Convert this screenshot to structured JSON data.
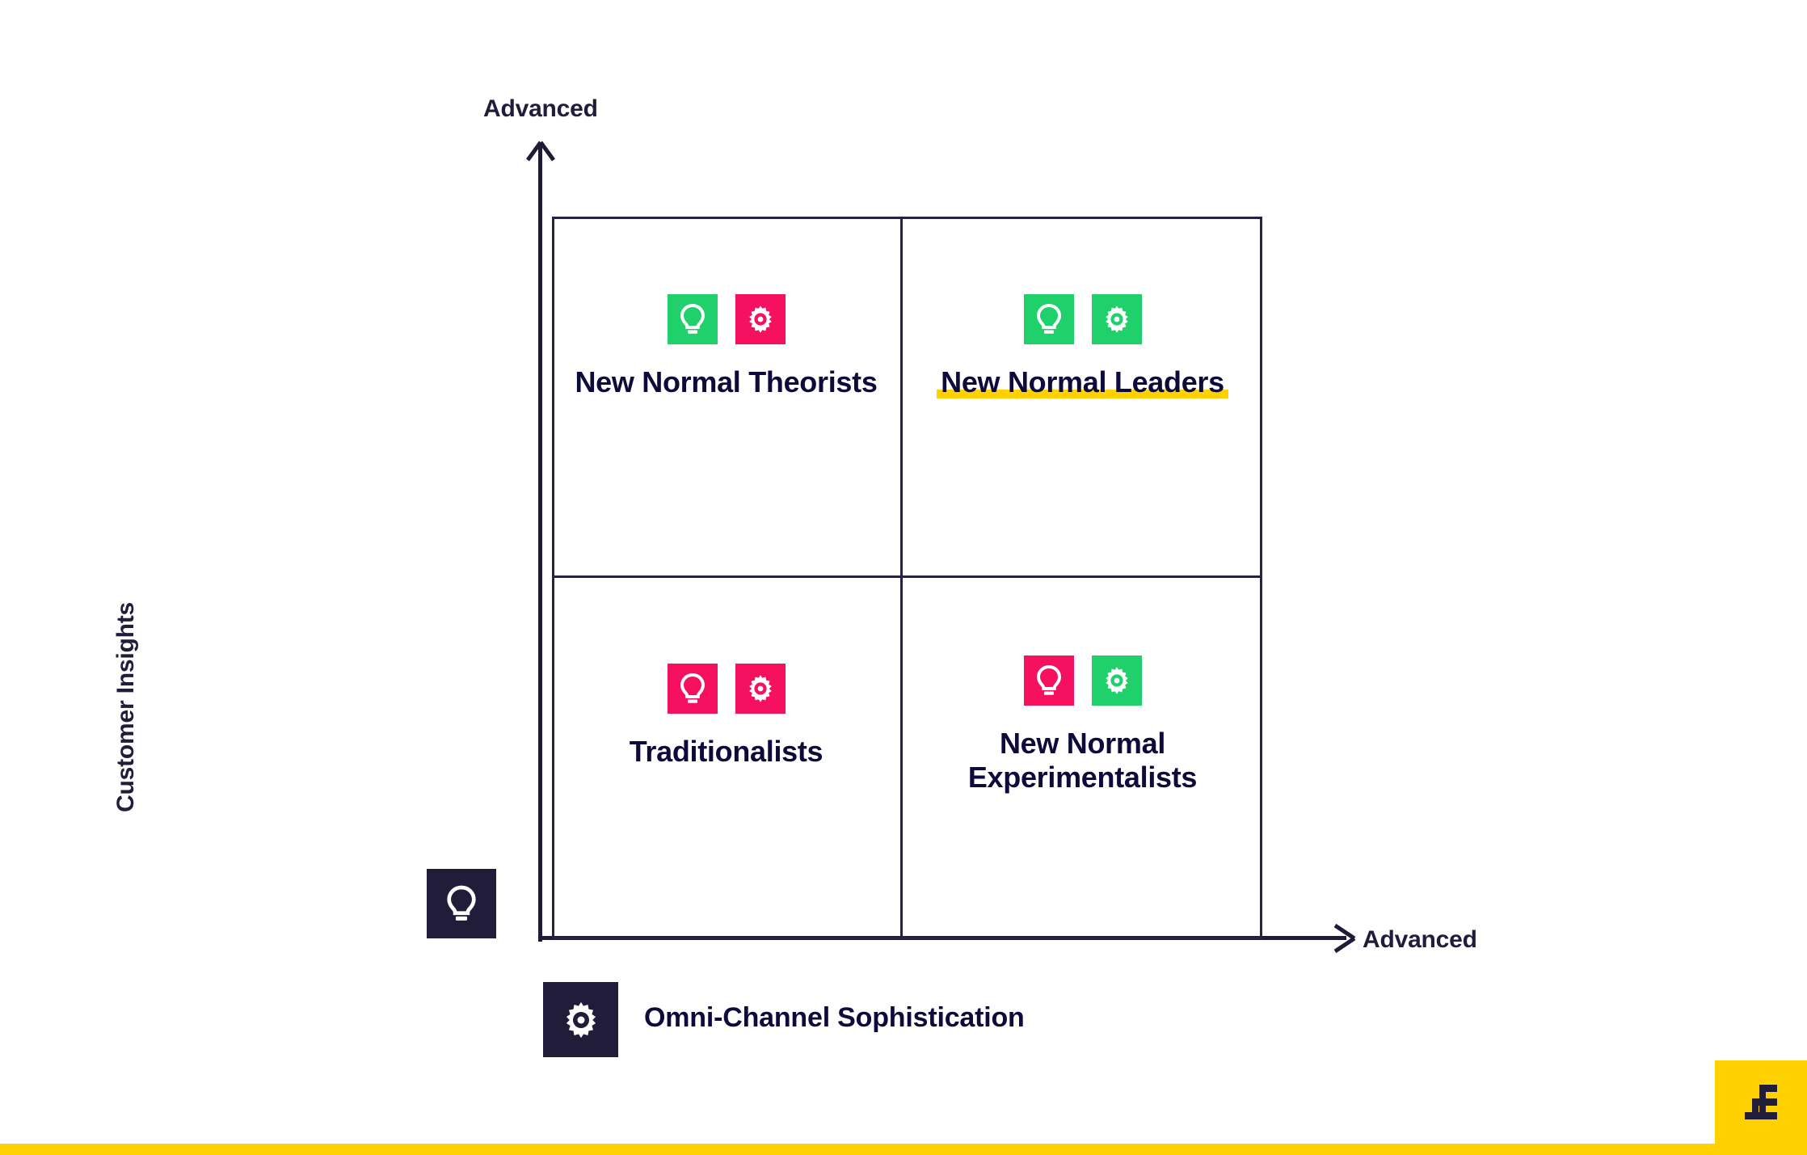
{
  "axes": {
    "y_tip_label": "Advanced",
    "x_tip_label": "Advanced",
    "y_axis_title": "Customer Insights",
    "x_axis_title": "Omni-Channel Sophistication"
  },
  "quadrants": [
    {
      "id": "top-left",
      "label_line1": "New Normal",
      "label_line2": "Theorists",
      "highlighted": false,
      "icons": [
        {
          "name": "lightbulb-icon",
          "color": "#20d16b",
          "meaning": "Customer Insights"
        },
        {
          "name": "gear-icon",
          "color": "#f5115f",
          "meaning": "Omni-Channel Sophistication"
        }
      ]
    },
    {
      "id": "top-right",
      "label_line1": "New Normal",
      "label_line2": "Leaders",
      "highlighted": true,
      "icons": [
        {
          "name": "lightbulb-icon",
          "color": "#20d16b",
          "meaning": "Customer Insights"
        },
        {
          "name": "gear-icon",
          "color": "#20d16b",
          "meaning": "Omni-Channel Sophistication"
        }
      ]
    },
    {
      "id": "bottom-left",
      "label_line1": "Traditionalists",
      "label_line2": "",
      "highlighted": false,
      "icons": [
        {
          "name": "lightbulb-icon",
          "color": "#f5115f",
          "meaning": "Customer Insights"
        },
        {
          "name": "gear-icon",
          "color": "#f5115f",
          "meaning": "Omni-Channel Sophistication"
        }
      ]
    },
    {
      "id": "bottom-right",
      "label_line1": "New Normal",
      "label_line2": "Experimentalists",
      "highlighted": false,
      "icons": [
        {
          "name": "lightbulb-icon",
          "color": "#f5115f",
          "meaning": "Customer Insights"
        },
        {
          "name": "gear-icon",
          "color": "#20d16b",
          "meaning": "Omni-Channel Sophistication"
        }
      ]
    }
  ],
  "legend": {
    "insights_icon": "lightbulb-icon",
    "omni_icon": "gear-icon",
    "omni_label": "Omni-Channel Sophistication"
  },
  "colors": {
    "navy": "#211c3a",
    "text_navy": "#0d0a3c",
    "green": "#20d16b",
    "pink": "#f5115f",
    "yellow": "#ffd100",
    "white": "#ffffff"
  },
  "chart_data": {
    "type": "scatter",
    "title": "",
    "xlabel": "Omni-Channel Sophistication",
    "ylabel": "Customer Insights",
    "x_axis_max_label": "Advanced",
    "y_axis_max_label": "Advanced",
    "grid": true,
    "legend_position": "bottom-left",
    "categories": [
      "New Normal Theorists",
      "New Normal Leaders",
      "Traditionalists",
      "New Normal Experimentalists"
    ],
    "points": [
      {
        "label": "New Normal Theorists",
        "quadrant": "top-left",
        "insights": "high",
        "omni": "low"
      },
      {
        "label": "New Normal Leaders",
        "quadrant": "top-right",
        "insights": "high",
        "omni": "high"
      },
      {
        "label": "Traditionalists",
        "quadrant": "bottom-left",
        "insights": "low",
        "omni": "low"
      },
      {
        "label": "New Normal Experimentalists",
        "quadrant": "bottom-right",
        "insights": "low",
        "omni": "high"
      }
    ]
  }
}
